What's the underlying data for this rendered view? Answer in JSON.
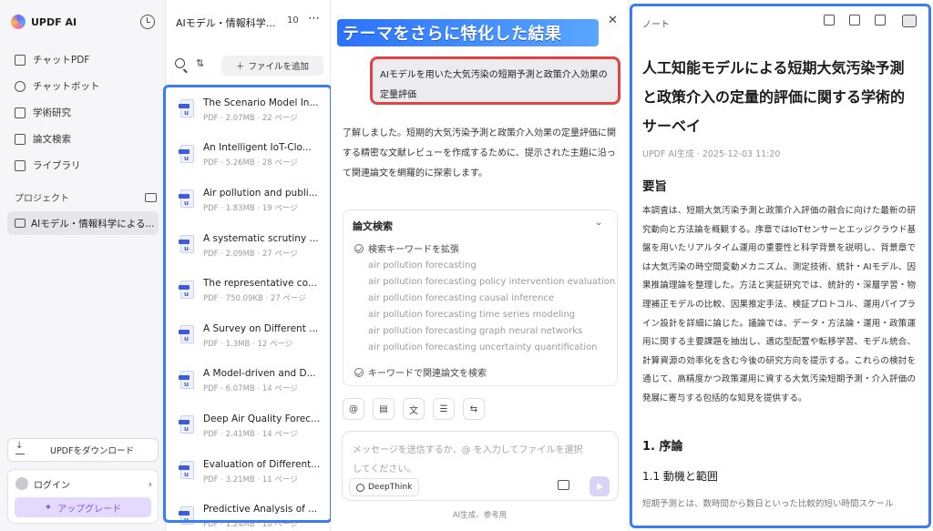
{
  "sidebar": {
    "brand": "UPDF AI",
    "nav": [
      {
        "label": "チャットPDF",
        "icon": "book-icon"
      },
      {
        "label": "チャットボット",
        "icon": "chatbot-icon"
      },
      {
        "label": "学術研究",
        "icon": "graduation-icon"
      },
      {
        "label": "論文検索",
        "icon": "paper-search-icon"
      },
      {
        "label": "ライブラリ",
        "icon": "library-icon"
      }
    ],
    "project_heading": "プロジェクト",
    "project_item": "AIモデル・情報科学による...",
    "download_label": "UPDFをダウンロード",
    "login_label": "ログイン",
    "upgrade_label": "アップグレード"
  },
  "filepanel": {
    "title": "AIモデル・情報科学...",
    "count": "10",
    "add_file_label": "ファイルを追加",
    "files": [
      {
        "name": "The Scenario Model In...",
        "meta": "PDF · 2.07MB · 22 ページ"
      },
      {
        "name": "An Intelligent IoT-Clo...",
        "meta": "PDF · 5.26MB · 28 ページ"
      },
      {
        "name": "Air pollution and publi...",
        "meta": "PDF · 1.83MB · 19 ページ"
      },
      {
        "name": "A systematic scrutiny ...",
        "meta": "PDF · 2.09MB · 27 ページ"
      },
      {
        "name": "The representative co...",
        "meta": "PDF · 750.09KB · 27 ページ"
      },
      {
        "name": "A Survey on Different ...",
        "meta": "PDF · 1.3MB · 12 ページ"
      },
      {
        "name": "A Model-driven and D...",
        "meta": "PDF · 6.07MB · 14 ページ"
      },
      {
        "name": "Deep Air Quality Forec...",
        "meta": "PDF · 2.41MB · 14 ページ"
      },
      {
        "name": "Evaluation of Different...",
        "meta": "PDF · 3.21MB · 11 ページ"
      },
      {
        "name": "Predictive Analysis of ...",
        "meta": "PDF · 1.24MB · 10 ページ"
      }
    ]
  },
  "chat": {
    "banner": "テーマをさらに特化した結果",
    "query": "AIモデルを用いた大気汚染の短期予測と政策介入効果の定量評価",
    "answer": "了解しました。短期的大気汚染予測と政策介入効果の定量評価に関する精密な文献レビューを作成するために、提示された主題に沿って関連論文を網羅的に探索します。",
    "search_card": {
      "title": "論文検索",
      "step1": "検索キーワードを拡張",
      "keywords": [
        "air pollution forecasting",
        "air pollution forecasting policy intervention evaluation",
        "air pollution forecasting causal inference",
        "air pollution forecasting time series modeling",
        "air pollution forecasting graph neural networks",
        "air pollution forecasting uncertainty quantification"
      ],
      "step2": "キーワードで関連論文を検索"
    },
    "input_placeholder": "メッセージを送信するか、@ を入力してファイルを選択してください。",
    "deepthink_label": "DeepThink",
    "footnote": "AI生成、参考用"
  },
  "note": {
    "label": "ノート",
    "title": "人工知能モデルによる短期大気汚染予測と政策介入の定量的評価に関する学術的サーベイ",
    "meta": "UPDF AI生成 · 2025-12-03 11:20",
    "summary_heading": "要旨",
    "summary": "本調査は、短期大気汚染予測と政策介入評価の融合に向けた最新の研究動向と方法論を概観する。序章ではIoTセンサーとエッジクラウド基盤を用いたリアルタイム運用の重要性と科学背景を説明し、背景章では大気汚染の時空間変動メカニズム、測定技術、統計・AIモデル、因果推論理論を整理した。方法と実証研究では、統計的・深層学習・物理補正モデルの比較、因果推定手法、検証プロトコル、運用パイプライン設計を詳細に論じた。議論では、データ・方法論・運用・政策運用に関する主要課題を抽出し、適応型配置や転移学習、モデル統合、計算資源の効率化を含む今後の研究方向を提示する。これらの検討を通じて、高精度かつ政策運用に資する大気汚染短期予測・介入評価の発展に寄与する包括的な知見を提供する。",
    "section1": "1. 序論",
    "section1_1": "1.1 動機と範囲",
    "tail": "短期予測とは、数時間から数日といった比較的短い時間スケール"
  }
}
